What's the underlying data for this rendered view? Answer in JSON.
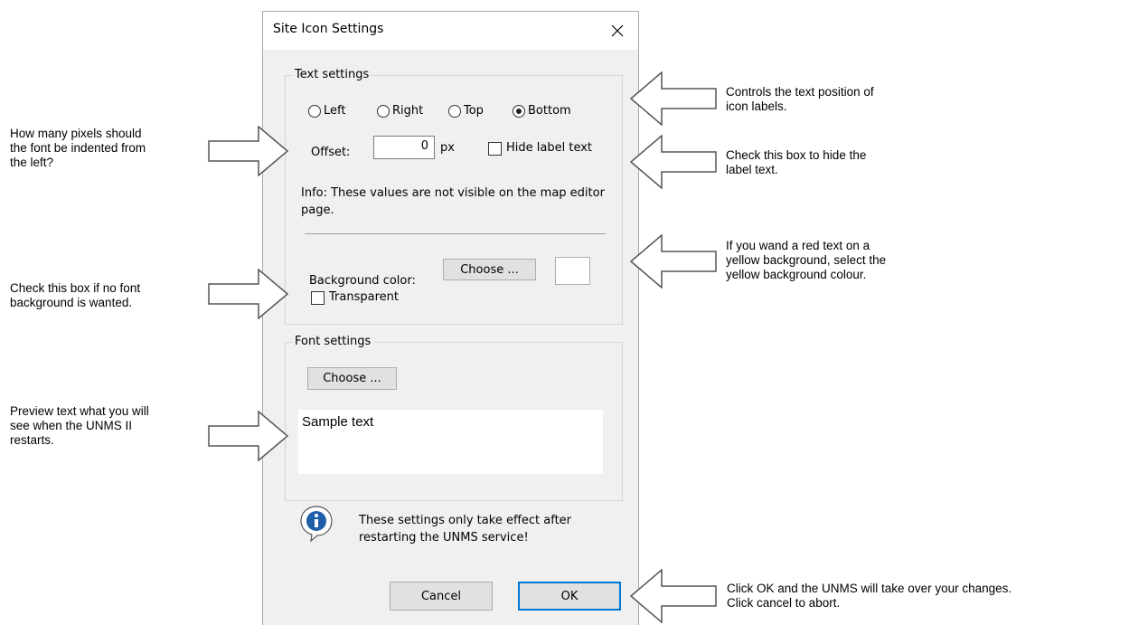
{
  "dialog": {
    "title": "Site Icon Settings",
    "close_glyph": "✕",
    "text_settings": {
      "label": "Text settings",
      "positions": [
        {
          "label": "Left",
          "checked": false
        },
        {
          "label": "Right",
          "checked": false
        },
        {
          "label": "Top",
          "checked": false
        },
        {
          "label": "Bottom",
          "checked": true
        }
      ],
      "offset_label": "Offset:",
      "offset_value": "0",
      "offset_unit": "px",
      "hide_label_text": "Hide label text",
      "info": "Info: These values are not visible on the map editor page.",
      "background_label": "Background color:",
      "choose_label": "Choose ...",
      "transparent_label": "Transparent"
    },
    "font_settings": {
      "label": "Font settings",
      "choose_label": "Choose ...",
      "sample_text": "Sample text"
    },
    "notice": "These settings only take effect after restarting the UNMS service!",
    "cancel_label": "Cancel",
    "ok_label": "OK"
  },
  "annotations": {
    "text_position": "Controls the text position of\nicon labels.",
    "offset": "How many pixels should\nthe font be indented from\nthe left?",
    "hide_label": "Check this box to hide the\nlabel text.",
    "background": "If you wand a red text on a\nyellow background, select the\nyellow background colour.",
    "transparent": "Check this box if no font\nbackground is wanted.",
    "preview": "Preview text what you will\nsee when the UNMS II\nrestarts.",
    "ok_cancel": "Click OK and the UNMS will take over your changes.\nClick cancel to abort."
  },
  "colors": {
    "dialog_bg": "#f0f0f0",
    "accent": "#0078d7",
    "info_icon": "#1f5fa8"
  },
  "icons": [
    "close-icon",
    "info-icon",
    "arrow-icon"
  ]
}
